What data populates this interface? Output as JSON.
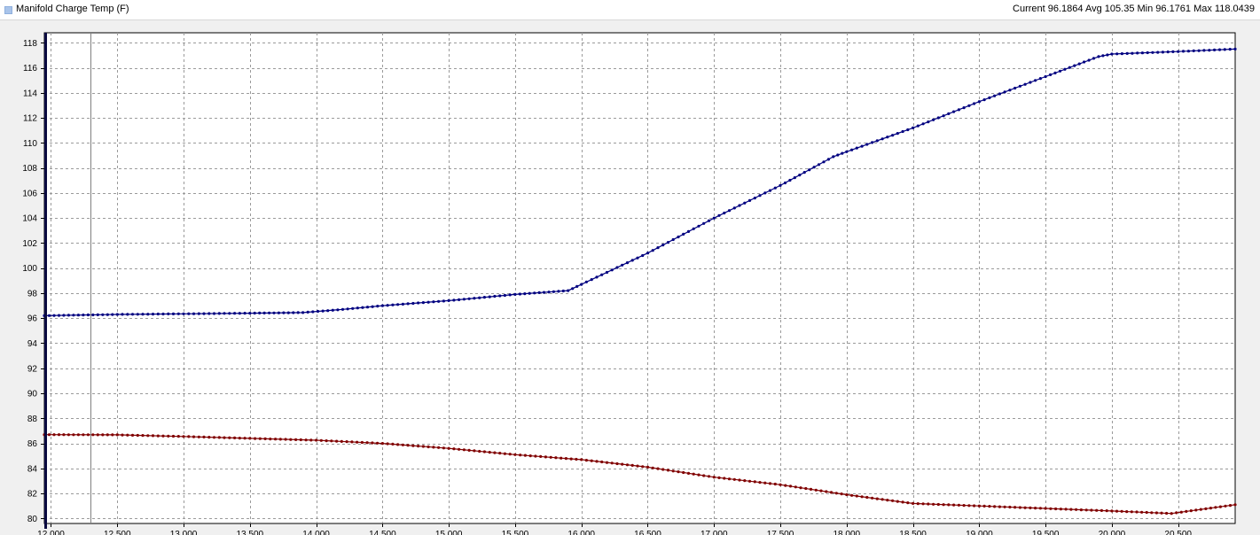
{
  "header": {
    "series_title": "Manifold Charge Temp (F)",
    "stats": "Current 96.1864 Avg 105.35 Min 96.1761 Max 118.0439"
  },
  "chart_data": {
    "type": "line",
    "title": "Manifold Charge Temp (F)",
    "xlabel": "",
    "ylabel": "",
    "xlim": [
      11.95,
      20.93
    ],
    "ylim": [
      79.6,
      118.8
    ],
    "grid": true,
    "cursor_x": 12.3,
    "x_ticks": [
      12.0,
      12.5,
      13.0,
      13.5,
      14.0,
      14.5,
      15.0,
      15.5,
      16.0,
      16.5,
      17.0,
      17.5,
      18.0,
      18.5,
      19.0,
      19.5,
      20.0,
      20.5
    ],
    "x_tick_labels": [
      "12.000",
      "12.500",
      "13.000",
      "13.500",
      "14.000",
      "14.500",
      "15.000",
      "15.500",
      "16.000",
      "16.500",
      "17.000",
      "17.500",
      "18.000",
      "18.500",
      "19.000",
      "19.500",
      "20.000",
      "20.500"
    ],
    "y_ticks": [
      80,
      82,
      84,
      86,
      88,
      90,
      92,
      94,
      96,
      98,
      100,
      102,
      104,
      106,
      108,
      110,
      112,
      114,
      116,
      118
    ],
    "y_tick_labels": [
      "80",
      "82",
      "84",
      "86",
      "88",
      "90",
      "92",
      "94",
      "96",
      "98",
      "100",
      "102",
      "104",
      "106",
      "108",
      "110",
      "112",
      "114",
      "116",
      "118"
    ],
    "series": [
      {
        "color": "#000080",
        "x": [
          11.95,
          12.5,
          13.0,
          13.5,
          13.9,
          14.2,
          14.5,
          15.0,
          15.5,
          15.9,
          16.0,
          16.5,
          17.0,
          17.5,
          17.9,
          18.0,
          18.5,
          19.0,
          19.5,
          19.9,
          20.0,
          20.5,
          20.93
        ],
        "y": [
          96.2,
          96.3,
          96.35,
          96.4,
          96.45,
          96.7,
          97.0,
          97.4,
          97.9,
          98.2,
          98.7,
          101.2,
          104.0,
          106.6,
          108.9,
          109.3,
          111.2,
          113.3,
          115.3,
          116.9,
          117.1,
          117.3,
          117.5
        ]
      },
      {
        "color": "#800000",
        "x": [
          11.95,
          12.5,
          13.0,
          13.5,
          14.0,
          14.5,
          15.0,
          15.5,
          16.0,
          16.5,
          17.0,
          17.5,
          18.0,
          18.5,
          19.0,
          19.5,
          20.0,
          20.45,
          20.93
        ],
        "y": [
          86.7,
          86.68,
          86.55,
          86.4,
          86.25,
          86.0,
          85.6,
          85.1,
          84.7,
          84.1,
          83.3,
          82.7,
          81.9,
          81.2,
          81.0,
          80.8,
          80.6,
          80.4,
          81.1
        ]
      }
    ]
  }
}
